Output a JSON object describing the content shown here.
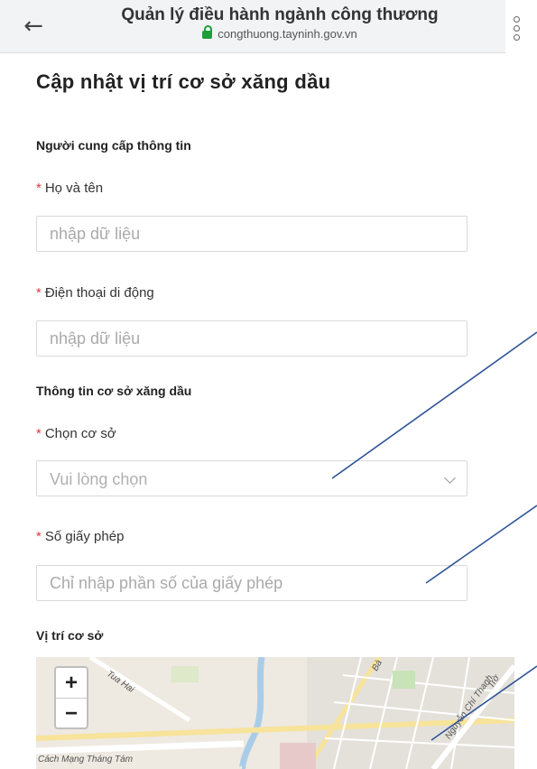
{
  "browser": {
    "title": "Quản lý điều hành ngành công thương",
    "url": "congthuong.tayninh.gov.vn",
    "back_glyph": "←"
  },
  "page": {
    "title": "Cập nhật vị trí cơ sở xăng dầu"
  },
  "provider_section": {
    "heading": "Người cung cấp thông tin",
    "name_label": "Họ và tên",
    "name_placeholder": "nhập dữ liệu",
    "phone_label": "Điện thoại di động",
    "phone_placeholder": "nhập dữ liệu"
  },
  "facility_section": {
    "heading": "Thông tin cơ sở xăng dầu",
    "select_label": "Chọn cơ sở",
    "select_value": "Vui lòng chọn",
    "license_label": "Số giấy phép",
    "license_placeholder": "Chỉ nhập phần số của giấy phép"
  },
  "location_section": {
    "heading": "Vị trí cơ sở",
    "zoom_in": "+",
    "zoom_out": "−",
    "street_labels": [
      "Tua Hai",
      "Cách Mạng Tháng Tám",
      "Nguyễn Chí Thanh",
      "Bà",
      "Trờ"
    ]
  },
  "required_marker": "*",
  "colors": {
    "required": "#e53935",
    "annotation_line": "#2f5597",
    "lock": "#1e9e3a"
  }
}
